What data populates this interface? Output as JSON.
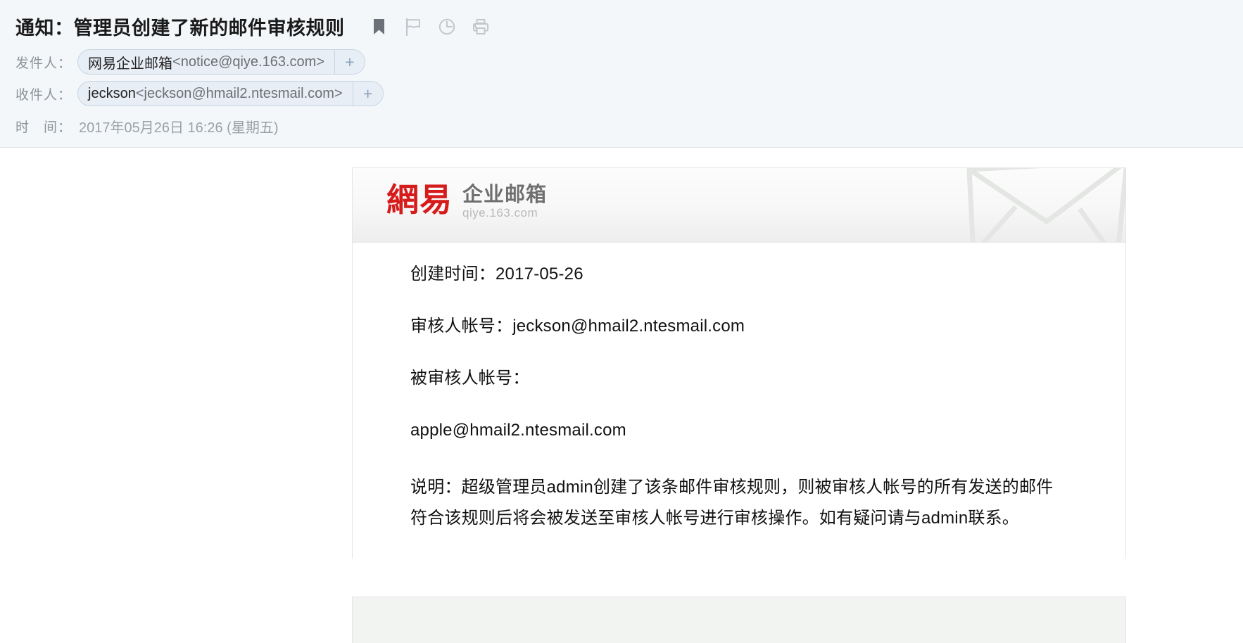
{
  "header": {
    "subject": "通知：管理员创建了新的邮件审核规则",
    "icons": [
      {
        "name": "bookmark-icon",
        "label": "书签"
      },
      {
        "name": "flag-icon",
        "label": "标记"
      },
      {
        "name": "clock-icon",
        "label": "定时"
      },
      {
        "name": "printer-icon",
        "label": "打印"
      }
    ],
    "from": {
      "label": "发件人：",
      "name": "网易企业邮箱",
      "address": "<notice@qiye.163.com>",
      "add_button": "+"
    },
    "to": {
      "label": "收件人：",
      "name": "jeckson",
      "address": "<jeckson@hmail2.ntesmail.com>",
      "add_button": "+"
    },
    "time": {
      "label": "时　间：",
      "value": "2017年05月26日 16:26 (星期五)"
    }
  },
  "card": {
    "logo": {
      "brand_cn": "網易",
      "product": "企业邮箱",
      "domain": "qiye.163.com",
      "watermark": "envelope-watermark"
    },
    "lines": [
      "创建时间：2017-05-26",
      "审核人帐号：jeckson@hmail2.ntesmail.com",
      "被审核人帐号：",
      "apple@hmail2.ntesmail.com"
    ],
    "description": "说明：超级管理员admin创建了该条邮件审核规则，则被审核人帐号的所有发送的邮件符合该规则后将会被发送至审核人帐号进行审核操作。如有疑问请与admin联系。"
  },
  "colors": {
    "header_bg": "#f4f7fa",
    "chip_bg": "#e8eef5",
    "chip_border": "#c6d5e3",
    "brand_red": "#d61b1b",
    "footer_bg": "#f2f4f2"
  }
}
